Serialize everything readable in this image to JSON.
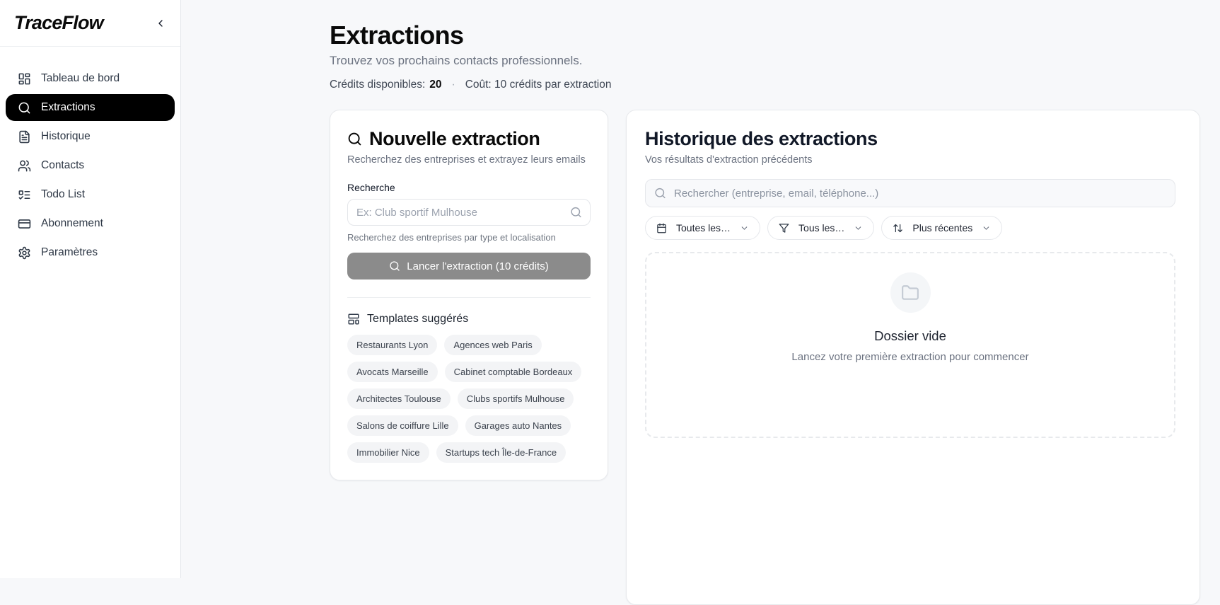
{
  "app": {
    "name": "TraceFlow"
  },
  "colors": {
    "active_nav_bg": "#000000",
    "active_nav_text": "#ffffff",
    "submit_button_bg": "#8b8b8b",
    "page_bg": "#f7f8fa",
    "chip_bg": "#f3f4f6",
    "muted_text": "#6b7280"
  },
  "sidebar": {
    "collapse_icon": "chevron-left",
    "items": [
      {
        "label": "Tableau de bord",
        "icon": "dashboard-icon",
        "active": false
      },
      {
        "label": "Extractions",
        "icon": "search-icon",
        "active": true
      },
      {
        "label": "Historique",
        "icon": "file-text-icon",
        "active": false
      },
      {
        "label": "Contacts",
        "icon": "users-icon",
        "active": false
      },
      {
        "label": "Todo List",
        "icon": "list-todo-icon",
        "active": false
      },
      {
        "label": "Abonnement",
        "icon": "credit-card-icon",
        "active": false
      },
      {
        "label": "Paramètres",
        "icon": "settings-icon",
        "active": false
      }
    ]
  },
  "header": {
    "title": "Extractions",
    "subtitle": "Trouvez vos prochains contacts professionnels.",
    "credits_label": "Crédits disponibles:",
    "credits_value": "20",
    "separator": "·",
    "cost_text": "Coût: 10 crédits par extraction"
  },
  "new_extraction": {
    "title": "Nouvelle extraction",
    "subtitle": "Recherchez des entreprises et extrayez leurs emails",
    "search_label": "Recherche",
    "search_placeholder": "Ex: Club sportif Mulhouse",
    "search_hint": "Recherchez des entreprises par type et localisation",
    "submit_label": "Lancer l'extraction (10 crédits)",
    "templates_title": "Templates suggérés",
    "templates": [
      "Restaurants Lyon",
      "Agences web Paris",
      "Avocats Marseille",
      "Cabinet comptable Bordeaux",
      "Architectes Toulouse",
      "Clubs sportifs Mulhouse",
      "Salons de coiffure Lille",
      "Garages auto Nantes",
      "Immobilier Nice",
      "Startups tech Île-de-France"
    ]
  },
  "history": {
    "title": "Historique des extractions",
    "subtitle": "Vos résultats d'extraction précédents",
    "search_placeholder": "Rechercher (entreprise, email, téléphone...)",
    "filters": [
      {
        "icon": "calendar-icon",
        "label": "Toutes les…"
      },
      {
        "icon": "filter-icon",
        "label": "Tous les…"
      },
      {
        "icon": "sort-icon",
        "label": "Plus récentes"
      }
    ],
    "empty": {
      "icon": "folder-icon",
      "title": "Dossier vide",
      "subtitle": "Lancez votre première extraction pour commencer"
    }
  }
}
